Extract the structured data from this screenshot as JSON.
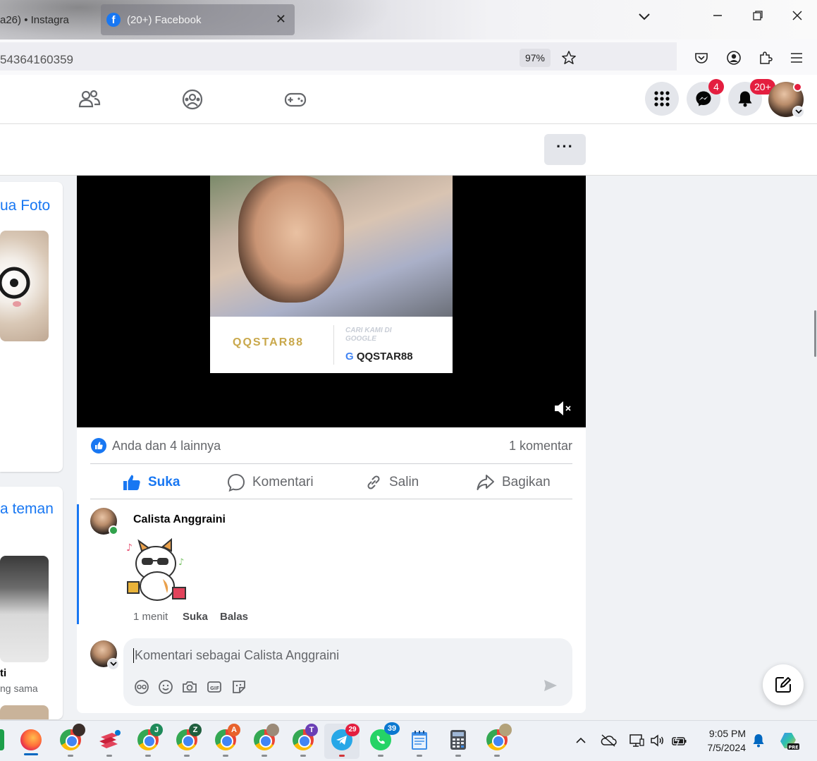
{
  "browser": {
    "tabs": [
      {
        "label": "a26) • Instagra",
        "active": false
      },
      {
        "label": "(20+) Facebook",
        "active": true
      }
    ],
    "url": "54364160359",
    "zoom": "97%"
  },
  "header": {
    "messenger_badge": "4",
    "notifications_badge": "20+"
  },
  "left_column": {
    "photos_link": "ua Foto",
    "friends_link": "a teman",
    "friend_name_partial": "ti",
    "friend_mutual_partial": "ng sama"
  },
  "post": {
    "ad": {
      "logo_text": "QQSTAR88",
      "tagline": "CARI KAMI DI GOOGLE",
      "brand": "QQSTAR88"
    },
    "reactions_text": "Anda dan 4 lainnya",
    "comments_count": "1 komentar",
    "actions": {
      "like": "Suka",
      "comment": "Komentari",
      "copy": "Salin",
      "share": "Bagikan"
    },
    "comment": {
      "author": "Calista Anggraini",
      "time": "1 menit",
      "like_label": "Suka",
      "reply_label": "Balas"
    },
    "compose_placeholder": "Komentari sebagai Calista Anggraini"
  },
  "taskbar": {
    "telegram_badge": "29",
    "whatsapp_badge": "39",
    "time": "9:05 PM",
    "date": "7/5/2024"
  },
  "colors": {
    "facebook_blue": "#1877f2",
    "badge_red": "#e41e3f",
    "gray_text": "#65676b"
  }
}
